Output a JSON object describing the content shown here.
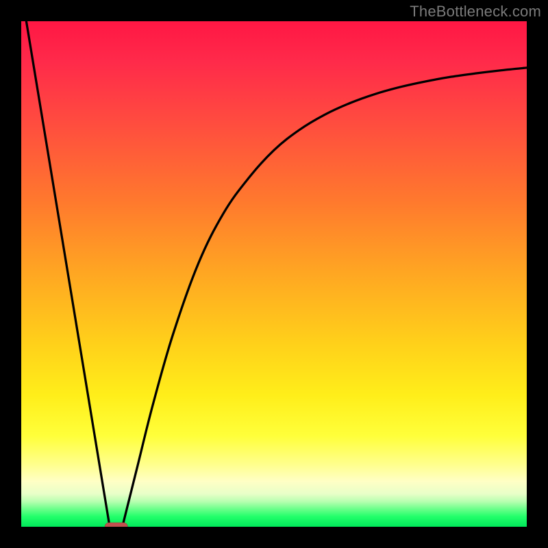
{
  "watermark": {
    "text": "TheBottleneck.com"
  },
  "colors": {
    "gradient_top": "#ff1744",
    "gradient_mid1": "#ff7a2d",
    "gradient_mid2": "#ffd11a",
    "gradient_mid3": "#ffff3a",
    "gradient_bottom": "#00e85a",
    "curve": "#000000",
    "frame": "#000000",
    "marker": "#c1504f"
  },
  "chart_data": {
    "type": "line",
    "title": "",
    "xlabel": "",
    "ylabel": "",
    "xlim": [
      0,
      100
    ],
    "ylim": [
      0,
      100
    ],
    "grid": false,
    "legend": false,
    "series": [
      {
        "name": "left-line",
        "comment": "Straight descending segment from top-left toward the trough.",
        "x": [
          1,
          17.5
        ],
        "y": [
          100,
          0
        ]
      },
      {
        "name": "right-curve",
        "comment": "Rising saturating curve from the trough toward upper right.",
        "x": [
          20,
          23,
          26,
          30,
          35,
          40,
          45,
          50,
          55,
          60,
          65,
          70,
          75,
          80,
          85,
          90,
          95,
          100
        ],
        "y": [
          0,
          12,
          24,
          38,
          52,
          62,
          69,
          74.5,
          78.5,
          81.5,
          83.8,
          85.6,
          87,
          88.1,
          89,
          89.7,
          90.3,
          90.8
        ]
      }
    ],
    "marker": {
      "comment": "Small rounded red marker at the trough on the green baseline.",
      "x_center": 18.8,
      "width": 4.5,
      "y": 0
    }
  }
}
